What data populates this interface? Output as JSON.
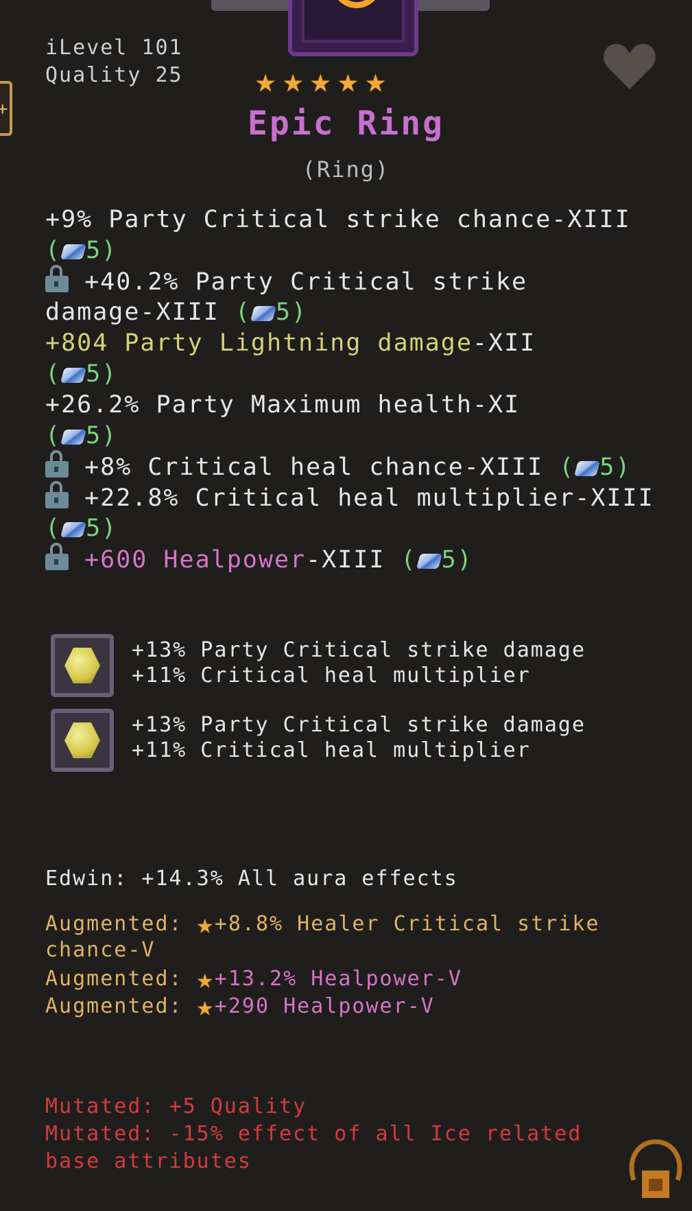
{
  "item": {
    "ilevel": "iLevel 101",
    "quality": "Quality 25",
    "stars": [
      "★",
      "★",
      "★",
      "★",
      "★"
    ],
    "name": "Epic Ring",
    "type": "(Ring)"
  },
  "stats": [
    {
      "l1": [
        {
          "t": "+9% Party Critical strike chance-XIII",
          "c": "white"
        }
      ],
      "l2": [
        {
          "t": "(",
          "c": "green"
        },
        {
          "gem": true
        },
        {
          "t": "5)",
          "c": "green"
        }
      ]
    },
    {
      "locked": true,
      "l1": [
        {
          "t": "+40.2% Party Critical strike",
          "c": "white"
        }
      ],
      "l2": [
        {
          "t": "damage-XIII ",
          "c": "white"
        },
        {
          "t": "(",
          "c": "green"
        },
        {
          "gem": true
        },
        {
          "t": "5)",
          "c": "green"
        }
      ]
    },
    {
      "l1": [
        {
          "t": "+804 Party Lightning damage",
          "c": "yellow"
        },
        {
          "t": "-XII",
          "c": "white"
        }
      ],
      "l2": [
        {
          "t": "(",
          "c": "green"
        },
        {
          "gem": true
        },
        {
          "t": "5)",
          "c": "green"
        }
      ]
    },
    {
      "l1": [
        {
          "t": "+26.2% Party Maximum health-XI",
          "c": "white"
        }
      ],
      "l2": [
        {
          "t": "(",
          "c": "green"
        },
        {
          "gem": true
        },
        {
          "t": "5)",
          "c": "green"
        }
      ]
    },
    {
      "locked": true,
      "l1": [
        {
          "t": "+8% Critical heal chance-XIII ",
          "c": "white"
        },
        {
          "t": "(",
          "c": "green"
        },
        {
          "gem": true
        },
        {
          "t": "5)",
          "c": "green"
        }
      ]
    },
    {
      "locked": true,
      "l1": [
        {
          "t": "+22.8% Critical heal multiplier-XIII",
          "c": "white"
        }
      ],
      "l2": [
        {
          "t": "(",
          "c": "green"
        },
        {
          "gem": true
        },
        {
          "t": "5)",
          "c": "green"
        }
      ]
    },
    {
      "locked": true,
      "l1": [
        {
          "t": "+600 Healpower",
          "c": "pink"
        },
        {
          "t": "-XIII ",
          "c": "white"
        },
        {
          "t": "(",
          "c": "green"
        },
        {
          "gem": true
        },
        {
          "t": "5)",
          "c": "green"
        }
      ]
    }
  ],
  "gems": [
    {
      "line1": "+13% Party Critical strike damage",
      "line2": "+11% Critical heal multiplier"
    },
    {
      "line1": "+13% Party Critical strike damage",
      "line2": "+11% Critical heal multiplier"
    }
  ],
  "aura": "Edwin: +14.3% All aura effects",
  "augments": {
    "label": "Augmented:",
    "a1_line1": "+8.8% Healer Critical strike",
    "a1_line2": "chance-V",
    "a2": "+13.2% Healpower-V",
    "a3": "+290 Healpower-V"
  },
  "mutations": {
    "m1": "Mutated: +5 Quality",
    "m2_line1": "Mutated: -15% effect of all Ice related",
    "m2_line2": "base attributes"
  },
  "colors": {
    "title": "#c86fd0",
    "stat_white": "#e6e6e6",
    "lightning_yellow": "#d6d272",
    "healpower_pink": "#d873c9",
    "gem_green": "#7bd37e",
    "augment_gold": "#e0b262",
    "mutation_red": "#d33b3f"
  },
  "icons": {
    "item": "ring-icon",
    "favorite": "heart-icon",
    "lock": "lock-icon",
    "gem": "rune-gem-icon",
    "socket": "yellow-socket-gem-icon",
    "augment": "star-icon",
    "bag": "bag-icon"
  }
}
